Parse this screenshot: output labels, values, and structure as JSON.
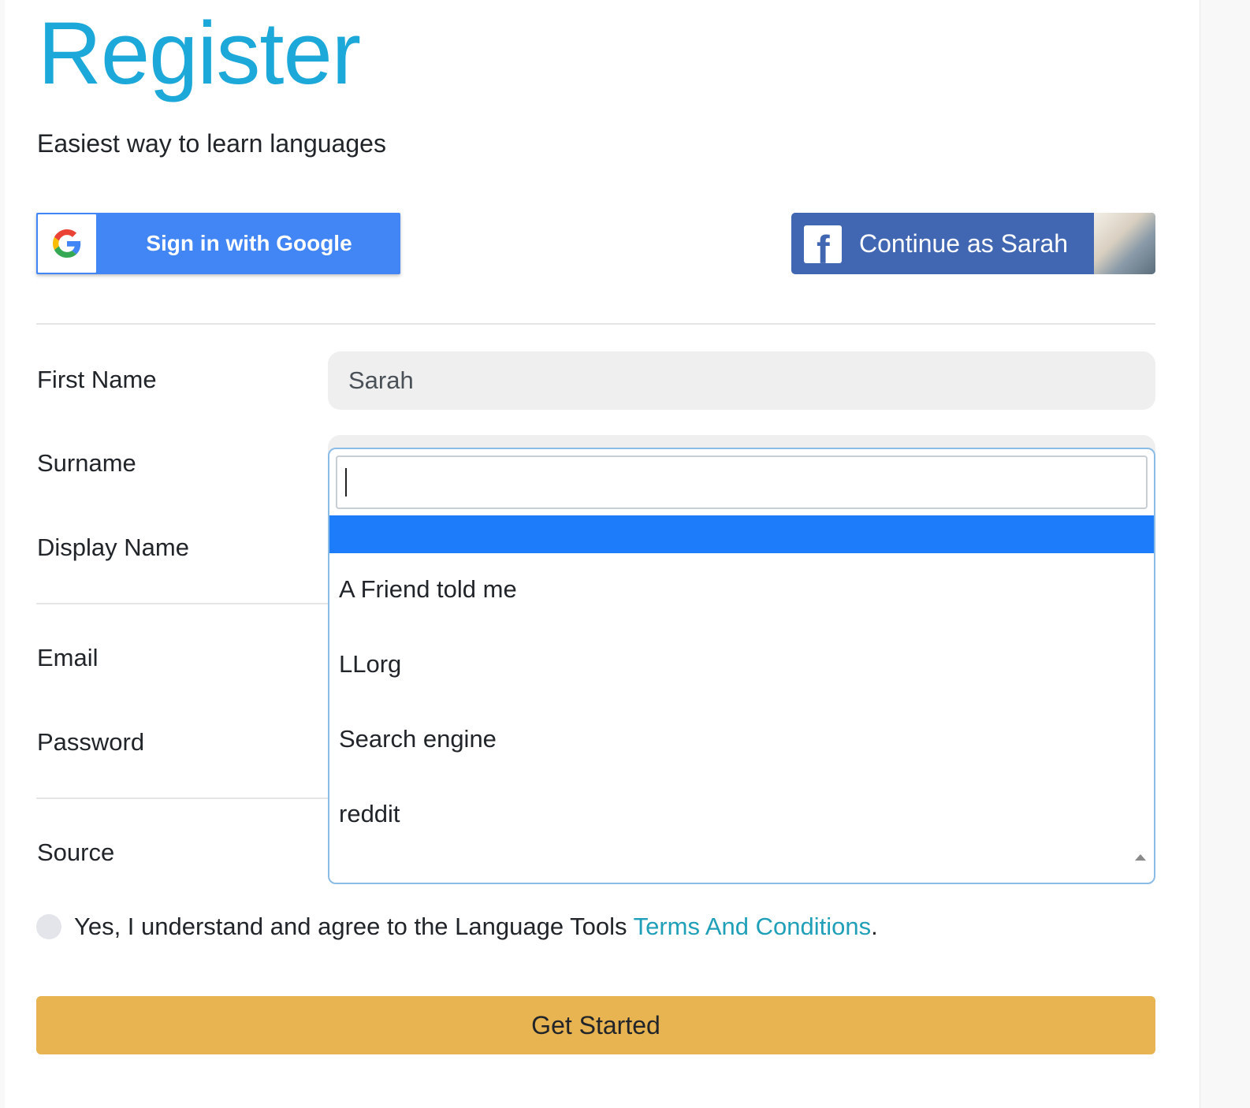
{
  "header": {
    "title": "Register",
    "subtitle": "Easiest way to learn languages"
  },
  "social": {
    "google_label": "Sign in with Google",
    "facebook_label": "Continue as Sarah"
  },
  "form": {
    "first_name_label": "First Name",
    "first_name_value": "Sarah",
    "surname_label": "Surname",
    "display_name_label": "Display Name",
    "email_label": "Email",
    "password_label": "Password",
    "source_label": "Source"
  },
  "source_dropdown": {
    "search_value": "",
    "highlighted_option": "",
    "options": [
      "A Friend told me",
      "LLorg",
      "Search engine",
      "reddit"
    ]
  },
  "agreement": {
    "text": "Yes, I understand and agree to the Language Tools ",
    "link_text": "Terms And Conditions",
    "suffix": "."
  },
  "submit": {
    "label": "Get Started"
  },
  "colors": {
    "title": "#1ca8d8",
    "google_blue": "#4285f4",
    "facebook_blue": "#4267b2",
    "highlight": "#1c7cf9",
    "link": "#1f9fb8",
    "submit": "#e8b351"
  },
  "icons": {
    "google": "google-g-icon",
    "facebook": "facebook-f-icon",
    "dropdown_arrow": "caret-up-icon"
  }
}
